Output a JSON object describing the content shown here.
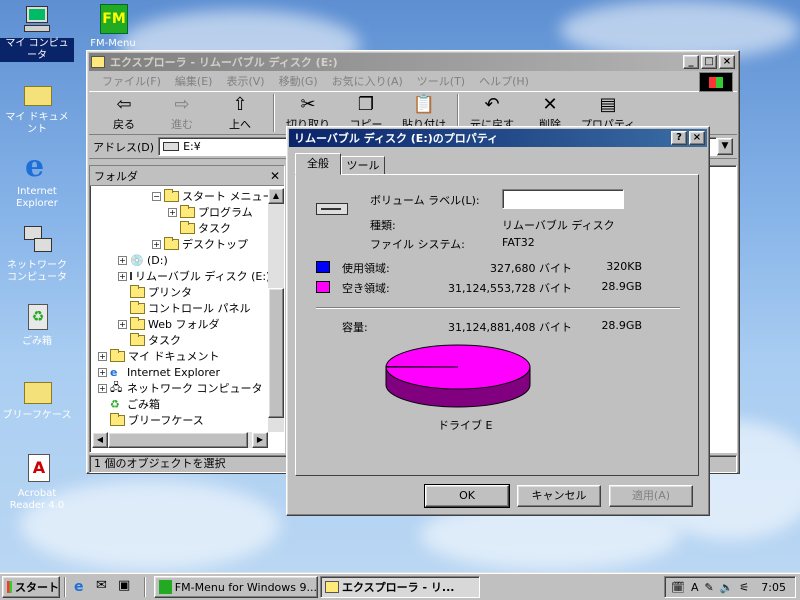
{
  "desktop": {
    "icons": [
      {
        "label": "マイ コンピュータ"
      },
      {
        "label": "FM-Menu"
      },
      {
        "label": "マイ ドキュメント"
      },
      {
        "label": "Internet Explorer"
      },
      {
        "label": "ネットワーク コンピュータ"
      },
      {
        "label": "ごみ箱"
      },
      {
        "label": "ブリーフケース"
      },
      {
        "label": "Acrobat Reader 4.0"
      }
    ]
  },
  "explorer": {
    "title": "エクスプローラ - リムーバブル ディスク (E:)",
    "menu": [
      "ファイル(F)",
      "編集(E)",
      "表示(V)",
      "移動(G)",
      "お気に入り(A)",
      "ツール(T)",
      "ヘルプ(H)"
    ],
    "toolbar": {
      "back": "戻る",
      "forward": "進む",
      "up": "上へ",
      "cut": "切り取り",
      "copy": "コピー",
      "paste": "貼り付け",
      "undo": "元に戻す",
      "delete": "削除",
      "properties": "プロパティ"
    },
    "address_label": "アドレス(D)",
    "address_value": "E:¥",
    "folder_pane_title": "フォルダ",
    "tree": [
      "スタート メニュー",
      "プログラム",
      "タスク",
      "デスクトップ",
      "(D:)",
      "リムーバブル ディスク (E:)",
      "プリンタ",
      "コントロール パネル",
      "Web フォルダ",
      "タスク",
      "マイ ドキュメント",
      "Internet Explorer",
      "ネットワーク コンピュータ",
      "ごみ箱",
      "ブリーフケース"
    ],
    "status": "1 個のオブジェクトを選択"
  },
  "dialog": {
    "title": "リムーバブル ディスク (E:)のプロパティ",
    "tabs": [
      "全般",
      "ツール"
    ],
    "volume_label_caption": "ボリューム ラベル(L):",
    "volume_label_value": "",
    "type_caption": "種類:",
    "type_value": "リムーバブル ディスク",
    "fs_caption": "ファイル システム:",
    "fs_value": "FAT32",
    "used_caption": "使用領域:",
    "used_bytes": "327,680 バイト",
    "used_human": "320KB",
    "free_caption": "空き領域:",
    "free_bytes": "31,124,553,728 バイト",
    "free_human": "28.9GB",
    "capacity_caption": "容量:",
    "capacity_bytes": "31,124,881,408 バイト",
    "capacity_human": "28.9GB",
    "drive_caption": "ドライブ E",
    "used_fraction": 1.05e-05,
    "ok": "OK",
    "cancel": "キャンセル",
    "apply": "適用(A)",
    "used_color": "#0000ff",
    "free_color": "#ff00ff"
  },
  "taskbar": {
    "start": "スタート",
    "tasks": [
      "FM-Menu for Windows 9...",
      "エクスプローラ - リ..."
    ],
    "clock": "7:05"
  }
}
